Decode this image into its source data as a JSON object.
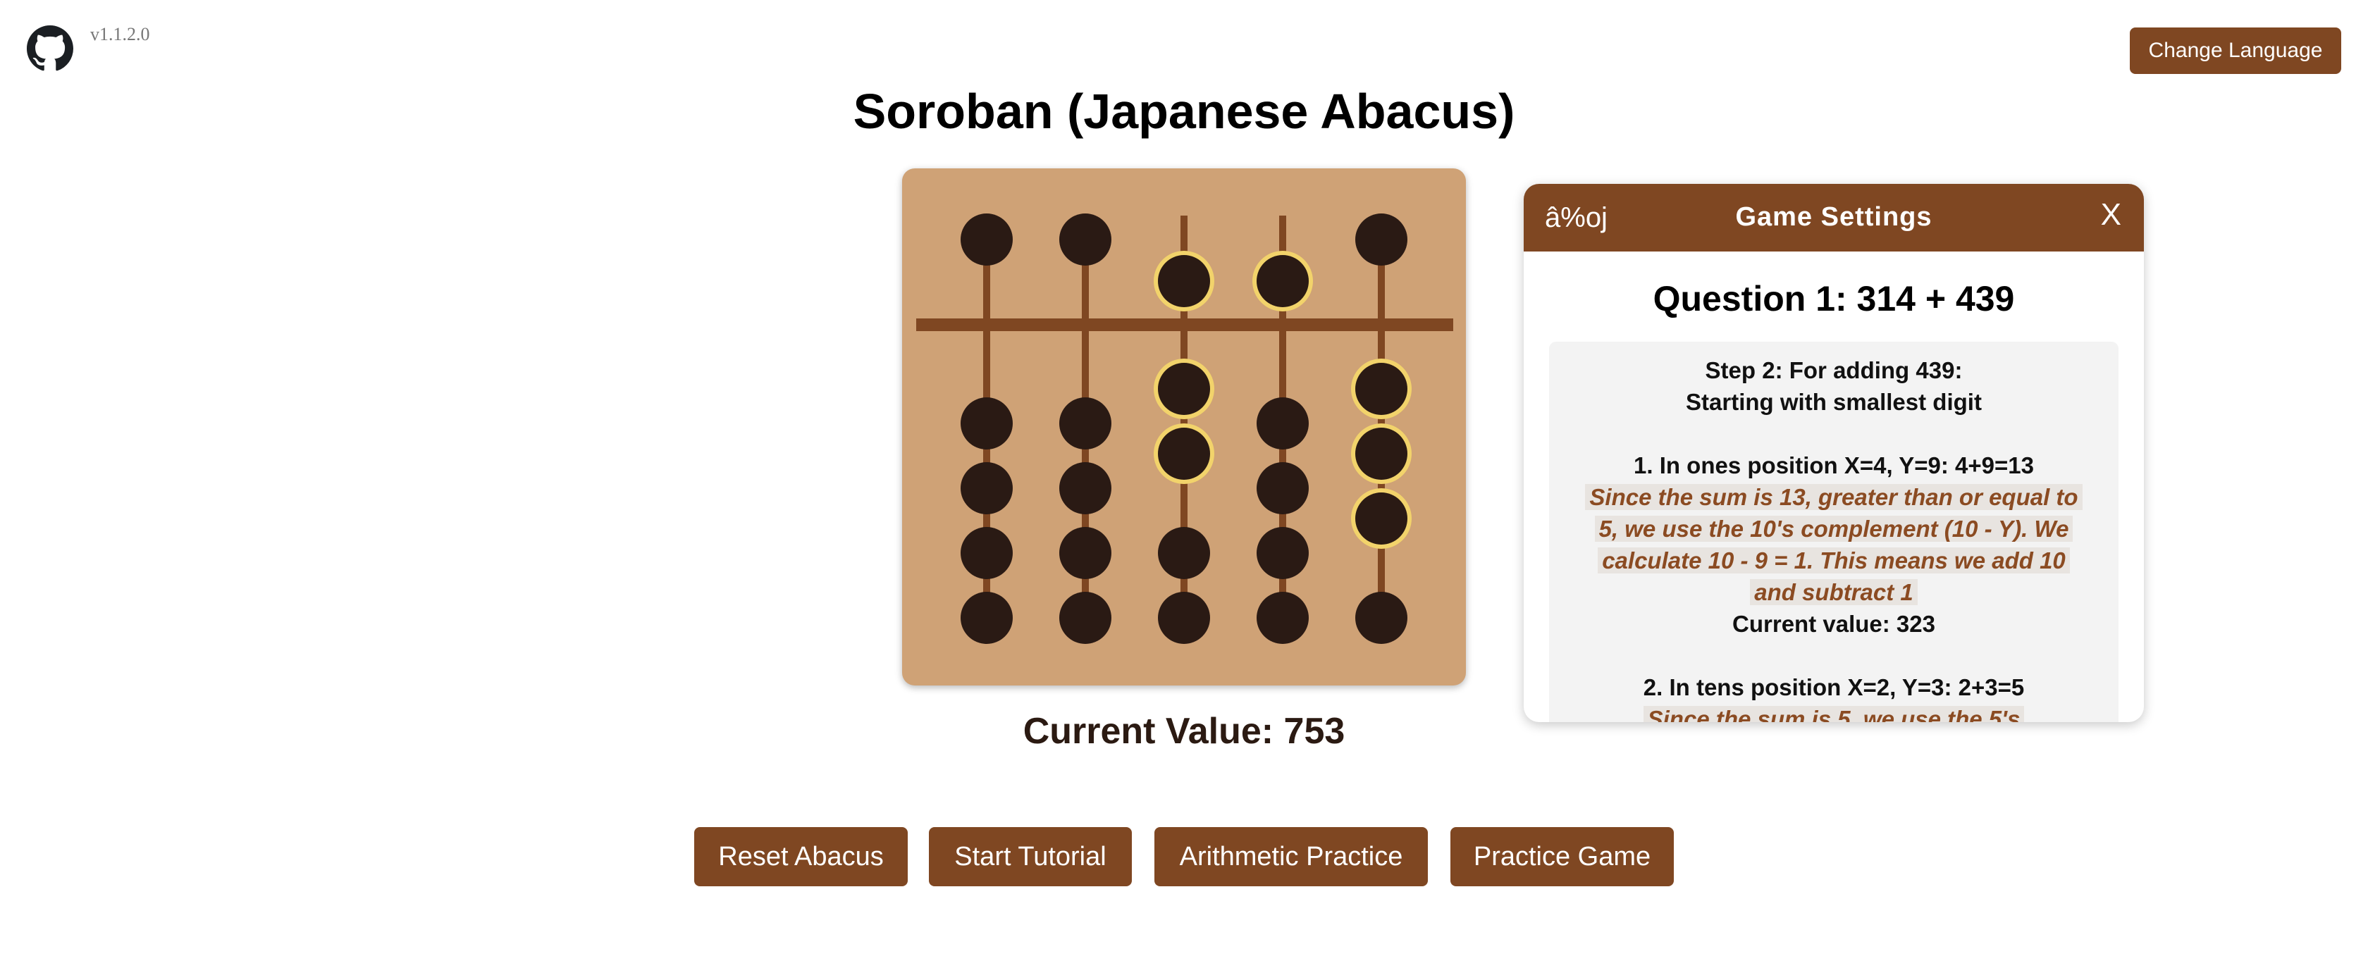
{
  "header": {
    "version": "v1.1.2.0",
    "change_language_label": "Change Language",
    "github_icon": "github-icon"
  },
  "title": "Soroban (Japanese Abacus)",
  "abacus": {
    "rods": [
      {
        "upper_active": false,
        "lower_active": 0,
        "highlight_upper": false,
        "highlight_lower": 0
      },
      {
        "upper_active": false,
        "lower_active": 0,
        "highlight_upper": false,
        "highlight_lower": 0
      },
      {
        "upper_active": true,
        "lower_active": 2,
        "highlight_upper": true,
        "highlight_lower": 2
      },
      {
        "upper_active": true,
        "lower_active": 0,
        "highlight_upper": true,
        "highlight_lower": 0
      },
      {
        "upper_active": false,
        "lower_active": 3,
        "highlight_upper": false,
        "highlight_lower": 3
      }
    ],
    "colors": {
      "frame": "#cfa276",
      "rod": "#7f4722",
      "bead": "#2a1a14",
      "highlight": "#f2d36b"
    }
  },
  "current_value_label": "Current Value: 753",
  "game_settings": {
    "icon_text": "â%oj",
    "title": "Game Settings",
    "close_label": "X",
    "question": "Question 1: 314 + 439",
    "step_heading_1": "Step 2: For adding 439:",
    "step_heading_2": "Starting with smallest digit",
    "item1_title": "1. In ones position X=4, Y=9: 4+9=13",
    "item1_note": "Since the sum is 13, greater than or equal to 5, we use the 10's complement (10 - Y). We calculate 10 - 9 = 1. This means we add 10 and subtract 1",
    "item1_value": "Current value: 323",
    "item2_title": "2. In tens position X=2, Y=3: 2+3=5",
    "item2_note": "Since the sum is 5, we use the 5's"
  },
  "actions": {
    "reset": "Reset Abacus",
    "tutorial": "Start Tutorial",
    "arithmetic": "Arithmetic Practice",
    "practice": "Practice Game"
  }
}
